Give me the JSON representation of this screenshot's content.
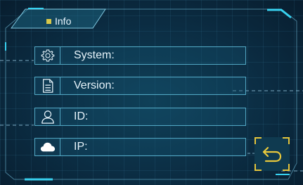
{
  "tab": {
    "label": "Info"
  },
  "rows": [
    {
      "label": "System:",
      "icon": "gear-icon"
    },
    {
      "label": "Version:",
      "icon": "document-icon"
    },
    {
      "label": "ID:",
      "icon": "user-icon"
    },
    {
      "label": "IP:",
      "icon": "cloud-icon"
    }
  ],
  "back_button": {
    "icon": "return-arrow-icon"
  },
  "colors": {
    "accent_cyan": "#35c8ea",
    "accent_yellow": "#e4c53c",
    "text": "#e6f3fa",
    "background": "#0b2c42"
  }
}
